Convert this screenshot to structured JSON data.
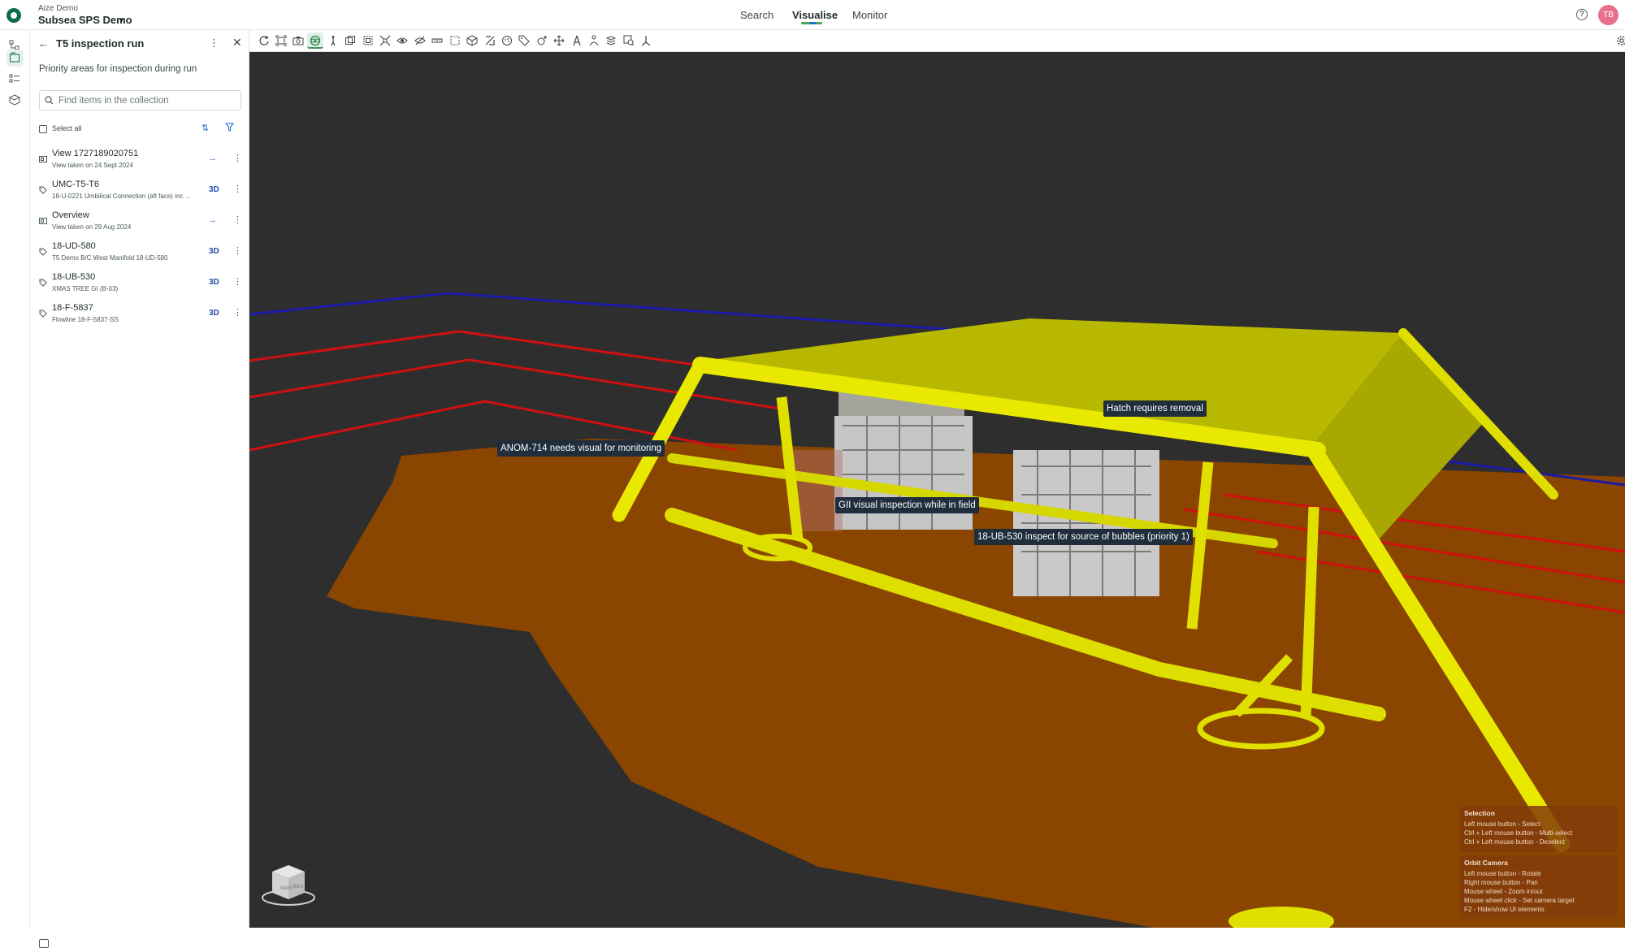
{
  "header": {
    "org": "Aize Demo",
    "project": "Subsea SPS Demo",
    "tabs": [
      "Search",
      "Visualise",
      "Monitor"
    ],
    "active_tab": "Visualise",
    "avatar_initials": "TB"
  },
  "panel": {
    "title": "T5 inspection run",
    "description": "Priority areas for inspection during run",
    "search_placeholder": "Find items in the collection",
    "select_all": "Select all",
    "items": [
      {
        "type": "view",
        "title": "View 1727189020751",
        "subtitle": "View taken on 24 Sept 2024",
        "action": "→"
      },
      {
        "type": "tag",
        "title": "UMC-T5-T6",
        "subtitle": "18-U-0221 Umbilical Connection (aft face) inc ...",
        "action": "3D"
      },
      {
        "type": "view",
        "title": "Overview",
        "subtitle": "View taken on 29 Aug 2024",
        "action": "→"
      },
      {
        "type": "tag",
        "title": "18-UD-580",
        "subtitle": "T5 Demo B/C West Manifold 18-UD-580",
        "action": "3D"
      },
      {
        "type": "tag",
        "title": "18-UB-530",
        "subtitle": "XMAS TREE GI (B-03)",
        "action": "3D"
      },
      {
        "type": "tag",
        "title": "18-F-5837",
        "subtitle": "Flowline 18-F-5837-SS",
        "action": "3D"
      }
    ]
  },
  "viewport": {
    "annotations": {
      "anom": "ANOM-714 needs visual for monitoring",
      "hatch": "Hatch requires removal",
      "gii": "GII visual inspection while in field",
      "ub530": "18-UB-530 inspect for source of bubbles (priority 1)"
    },
    "help_selection": {
      "title": "Selection",
      "lines": [
        "Left mouse button - Select",
        "Ctrl + Left mouse button - Multi-select",
        "Ctrl + Left mouse button - Deselect"
      ]
    },
    "help_camera": {
      "title": "Orbit Camera",
      "lines": [
        "Left mouse button - Rotate",
        "Right mouse button - Pan",
        "Mouse wheel - Zoom in/out",
        "Mouse wheel click - Set camera target",
        "F2 - Hide/show UI elements"
      ]
    },
    "nav_cube": {
      "front": "North",
      "right": "West"
    }
  },
  "colors": {
    "accent": "#0c6b4a",
    "seabed": "#8a4500",
    "structure": "#e6e600",
    "pipe_red": "#d01010",
    "pipe_blue": "#1a1aa8",
    "annotation_bg": "#1f2d3d"
  },
  "icons": {
    "toolbar": [
      "rotate-icon",
      "fit-view-icon",
      "camera-icon",
      "orbit-icon",
      "walk-icon",
      "section-box-icon",
      "section-icon",
      "explode-icon",
      "visibility-icon",
      "hide-icon",
      "measure-icon",
      "area-select-icon",
      "cube-icon",
      "slice-icon",
      "point-cloud-icon",
      "tag-icon",
      "add-point-icon",
      "move-icon",
      "survey-icon",
      "person-icon",
      "layers-icon",
      "zoom-region-icon",
      "axis-icon"
    ]
  }
}
